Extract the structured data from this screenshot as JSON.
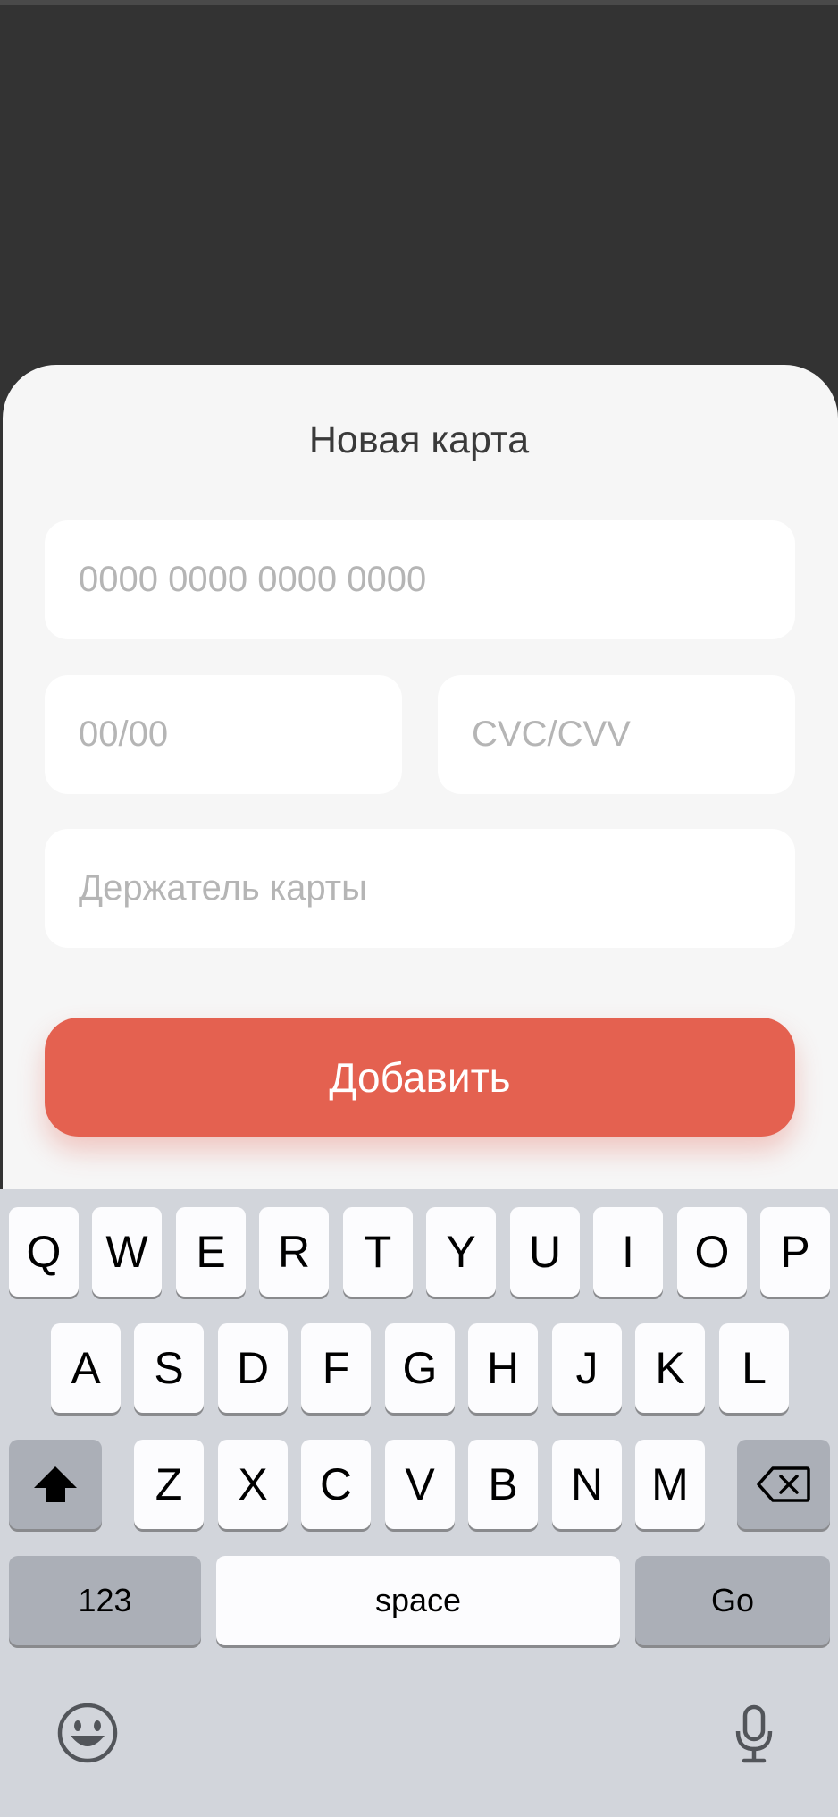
{
  "sheet": {
    "title": "Новая карта",
    "card_number_placeholder": "0000 0000 0000 0000",
    "expiry_placeholder": "00/00",
    "cvc_placeholder": "CVC/CVV",
    "holder_placeholder": "Держатель карты",
    "add_button_label": "Добавить",
    "accent_color": "#e46150"
  },
  "keyboard": {
    "row1": [
      "Q",
      "W",
      "E",
      "R",
      "T",
      "Y",
      "U",
      "I",
      "O",
      "P"
    ],
    "row2": [
      "A",
      "S",
      "D",
      "F",
      "G",
      "H",
      "J",
      "K",
      "L"
    ],
    "row3": [
      "Z",
      "X",
      "C",
      "V",
      "B",
      "N",
      "M"
    ],
    "numbers_label": "123",
    "space_label": "space",
    "go_label": "Go",
    "icons": [
      "shift-icon",
      "backspace-icon",
      "emoji-icon",
      "microphone-icon"
    ]
  }
}
